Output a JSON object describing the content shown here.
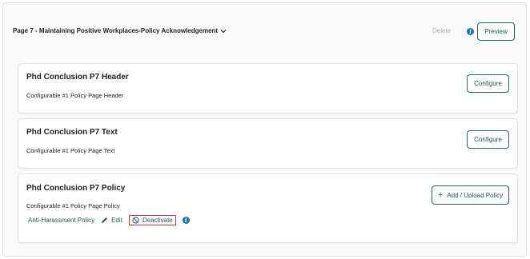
{
  "header": {
    "page_title": "Page 7 - Maintaining Positive Workplaces-Policy Acknowledgement",
    "delete_label": "Delete",
    "preview_label": "Preview"
  },
  "cards": [
    {
      "title": "Phd Conclusion P7 Header",
      "subtitle": "Configurable #1 Policy Page Header",
      "button_label": "Configure"
    },
    {
      "title": "Phd Conclusion P7 Text",
      "subtitle": "Configurable #1 Policy Page Text",
      "button_label": "Configure"
    },
    {
      "title": "Phd Conclusion P7 Policy",
      "subtitle": "Configurable #1 Policy Page Policy",
      "button_label": "Add / Upload Policy",
      "policy": {
        "link_label": "Anti-Harassment Policy",
        "edit_label": "Edit",
        "deactivate_label": "Deactivate"
      }
    }
  ],
  "icons": {
    "chevron": "chevron-down-icon",
    "info": "info-icon",
    "pencil": "pencil-icon",
    "ban": "ban-icon",
    "plus": "plus-icon"
  },
  "colors": {
    "accent": "#1d5a53",
    "info_blue": "#1a6fc4",
    "highlight_red": "#d9312c",
    "muted": "#aaaaaa"
  }
}
